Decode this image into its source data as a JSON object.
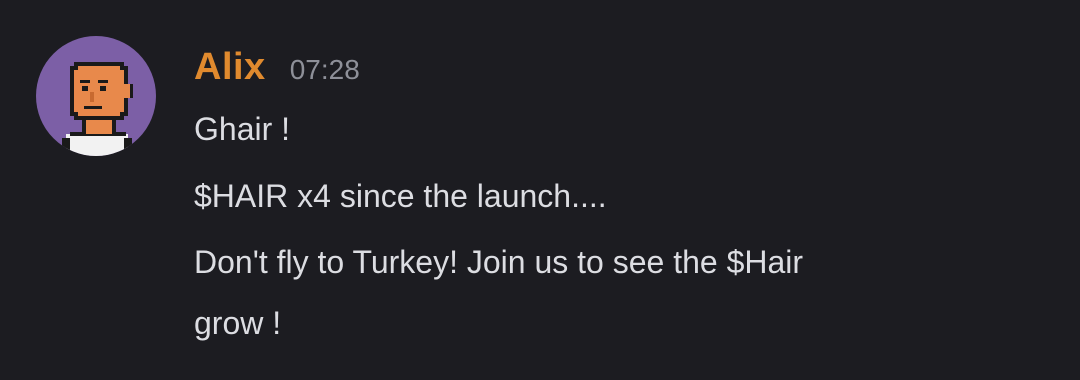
{
  "message": {
    "author": "Alix",
    "timestamp": "07:28",
    "avatar_icon": "pixel-art-bald-man-avatar",
    "colors": {
      "background": "#1c1c21",
      "author": "#e08a2e",
      "timestamp": "#8e9099",
      "text": "#dcdde2",
      "avatar_bg": "#7c5fa6",
      "avatar_skin": "#e8894b"
    },
    "lines": [
      "Ghair !",
      "$HAIR x4 since the launch....",
      "Don't fly to Turkey! Join us to see the $Hair",
      "grow !"
    ]
  }
}
